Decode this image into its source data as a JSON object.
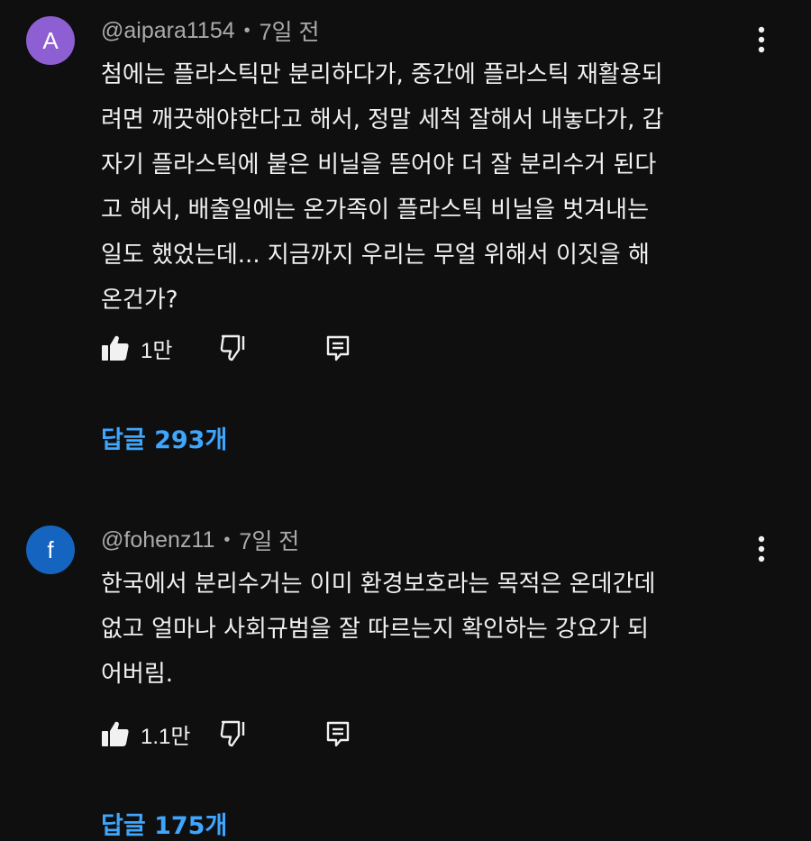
{
  "comments": [
    {
      "avatar_letter": "A",
      "avatar_color": "#8e5fd2",
      "handle": "@aipara1154",
      "separator": "•",
      "time": "7일 전",
      "text": "첨에는 플라스틱만 분리하다가, 중간에 플라스틱 재활용되\n려면 깨끗해야한다고 해서, 정말 세척 잘해서 내놓다가, 갑\n자기 플라스틱에 붙은 비닐을 뜯어야 더 잘 분리수거 된다\n고 해서, 배출일에는 온가족이 플라스틱 비닐을 벗겨내는\n일도 했었는데... 지금까지 우리는 무얼 위해서 이짓을 해\n온건가?",
      "likes": "1만",
      "replies": "답글 293개",
      "icons": [
        "more-vert-icon",
        "thumb-up-icon",
        "thumb-down-icon",
        "reply-icon"
      ]
    },
    {
      "avatar_letter": "f",
      "avatar_color": "#1565c0",
      "handle": "@fohenz11",
      "separator": "•",
      "time": "7일 전",
      "text": "한국에서 분리수거는 이미 환경보호라는 목적은 온데간데\n없고 얼마나 사회규범을 잘 따르는지 확인하는  강요가 되\n어버림.",
      "likes": "1.1만",
      "replies": "답글 175개",
      "icons": [
        "more-vert-icon",
        "thumb-up-icon",
        "thumb-down-icon",
        "reply-icon"
      ]
    }
  ],
  "colors": {
    "background": "#0f0f0f",
    "text": "#f1f1f1",
    "meta": "#aaaaaa",
    "link": "#3ea6ff"
  }
}
